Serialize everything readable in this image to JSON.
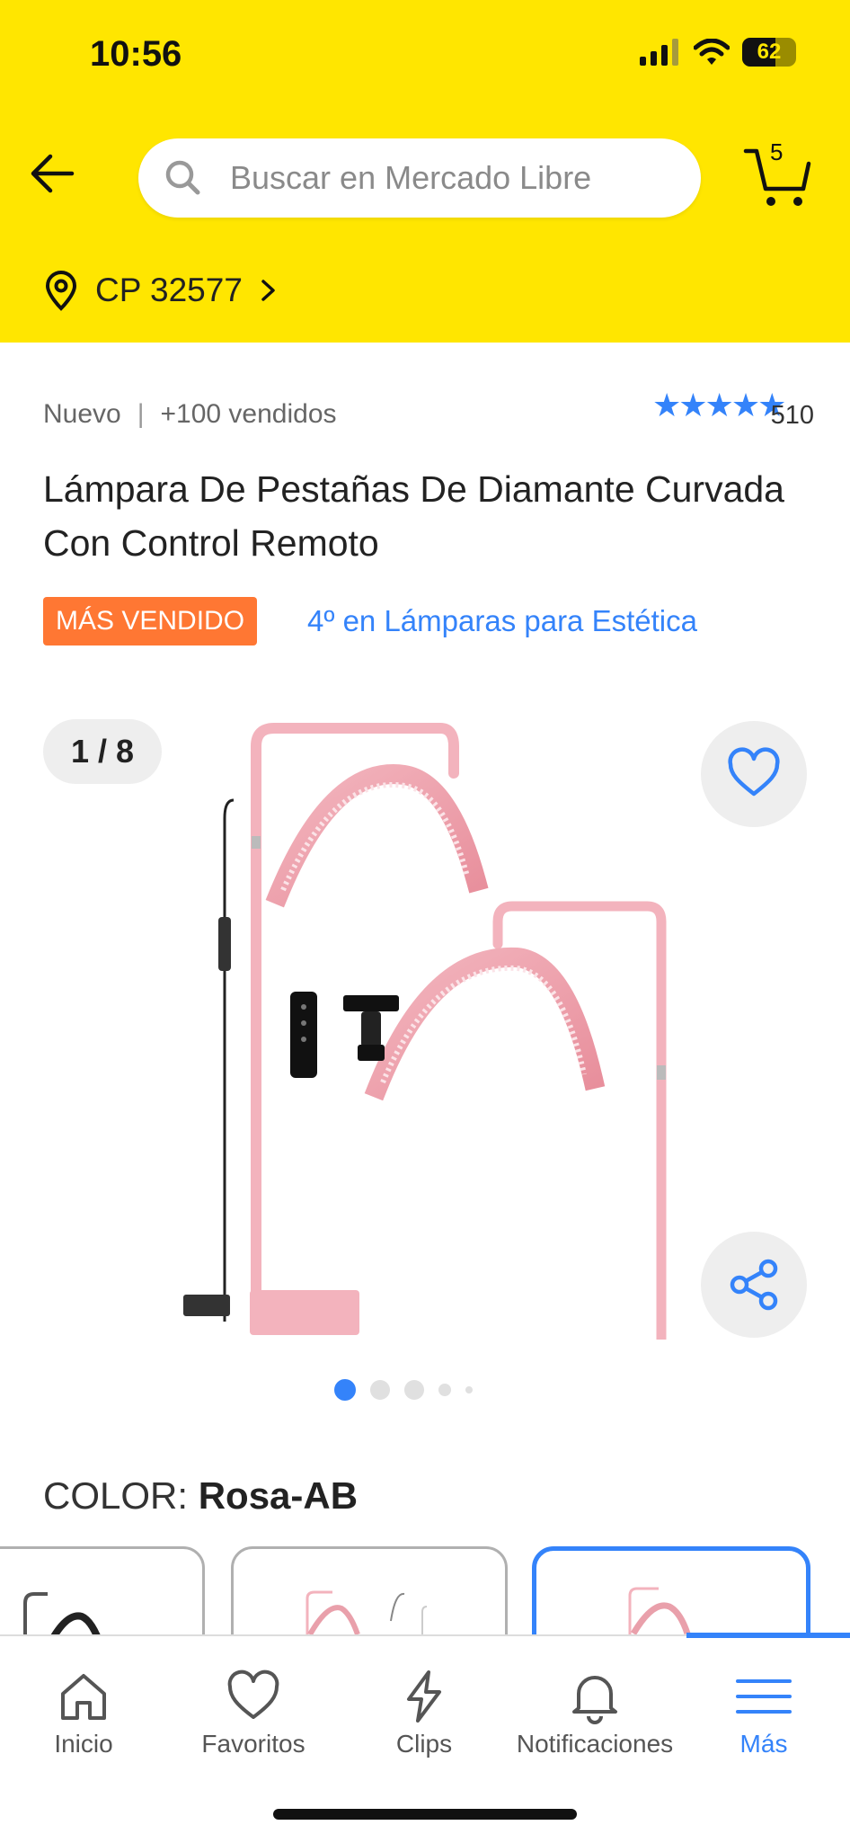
{
  "status_bar": {
    "time": "10:56",
    "battery": "62",
    "battery_level": 0.62
  },
  "search": {
    "placeholder": "Buscar en Mercado Libre"
  },
  "cart": {
    "count": "5"
  },
  "location": {
    "label": "CP 32577"
  },
  "product": {
    "condition": "Nuevo",
    "sold": "+100 vendidos",
    "rating_value": 5,
    "rating_count": "510",
    "title": "Lámpara De Pestañas De Diamante Curvada Con Control Remoto",
    "badge": "MÁS VENDIDO",
    "ranking": "4º en Lámparas para Estética"
  },
  "gallery": {
    "counter": "1 / 8",
    "total_dots": 5,
    "active_dot": 0
  },
  "color": {
    "label": "COLOR:",
    "value": "Rosa-AB",
    "selected_index": 2
  },
  "tabbar": {
    "items": [
      {
        "label": "Inicio",
        "icon": "home-icon"
      },
      {
        "label": "Favoritos",
        "icon": "heart-icon"
      },
      {
        "label": "Clips",
        "icon": "lightning-icon"
      },
      {
        "label": "Notificaciones",
        "icon": "bell-icon"
      },
      {
        "label": "Más",
        "icon": "menu-icon"
      }
    ],
    "active_index": 4
  },
  "colors": {
    "header": "#FFE600",
    "accent": "#3483FA",
    "badge": "#FF7733"
  }
}
